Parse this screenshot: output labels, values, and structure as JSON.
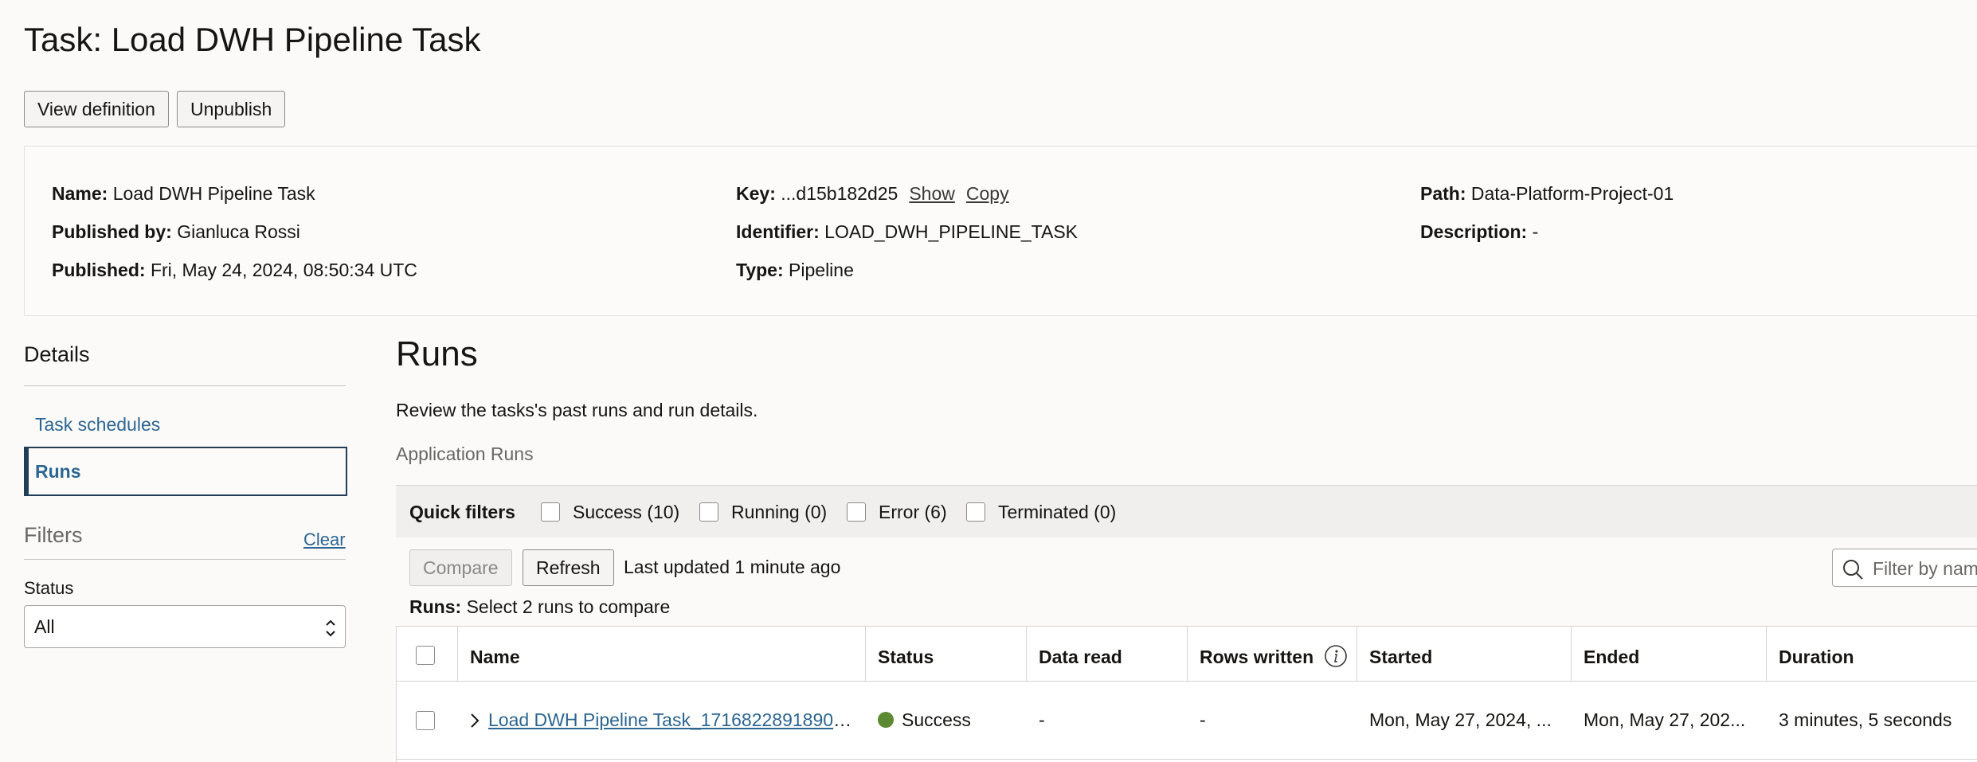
{
  "header": {
    "title": "Task: Load DWH Pipeline Task"
  },
  "actions": {
    "view_definition": "View definition",
    "unpublish": "Unpublish"
  },
  "info": {
    "name_label": "Name:",
    "name_value": "Load DWH Pipeline Task",
    "published_by_label": "Published by:",
    "published_by_value": "Gianluca Rossi",
    "published_label": "Published:",
    "published_value": "Fri, May 24, 2024, 08:50:34 UTC",
    "key_label": "Key:",
    "key_value": "...d15b182d25",
    "key_show": "Show",
    "key_copy": "Copy",
    "identifier_label": "Identifier:",
    "identifier_value": "LOAD_DWH_PIPELINE_TASK",
    "type_label": "Type:",
    "type_value": "Pipeline",
    "path_label": "Path:",
    "path_value": "Data-Platform-Project-01",
    "description_label": "Description:",
    "description_value": "-"
  },
  "sidebar": {
    "title": "Details",
    "items": [
      {
        "label": "Task schedules"
      },
      {
        "label": "Runs"
      }
    ],
    "filters_title": "Filters",
    "clear_label": "Clear",
    "status_label": "Status",
    "status_value": "All"
  },
  "main": {
    "title": "Runs",
    "description": "Review the tasks's past runs and run details.",
    "section_label": "Application Runs",
    "quick_filters": {
      "label": "Quick filters",
      "items": [
        {
          "label": "Success (10)"
        },
        {
          "label": "Running (0)"
        },
        {
          "label": "Error (6)"
        },
        {
          "label": "Terminated (0)"
        }
      ]
    },
    "toolbar": {
      "compare": "Compare",
      "refresh": "Refresh",
      "last_updated": "Last updated 1 minute ago",
      "filter_placeholder": "Filter by name",
      "runs_label": "Runs:",
      "runs_hint": "Select 2 runs to compare"
    },
    "table": {
      "columns": [
        "Name",
        "Status",
        "Data read",
        "Rows written",
        "Started",
        "Ended",
        "Duration"
      ],
      "rows": [
        {
          "name": "Load DWH Pipeline Task_1716822891890_...",
          "status": "Success",
          "data_read": "-",
          "rows_written": "-",
          "started": "Mon, May 27, 2024, ...",
          "ended": "Mon, May 27, 202...",
          "duration": "3 minutes, 5 seconds"
        }
      ]
    }
  },
  "colors": {
    "accent": "#2b6592",
    "success": "#5b8a32",
    "focus_border": "#203e58"
  },
  "icons": [
    "search-icon",
    "info-icon",
    "chevron-right-icon",
    "select-arrows-icon"
  ]
}
